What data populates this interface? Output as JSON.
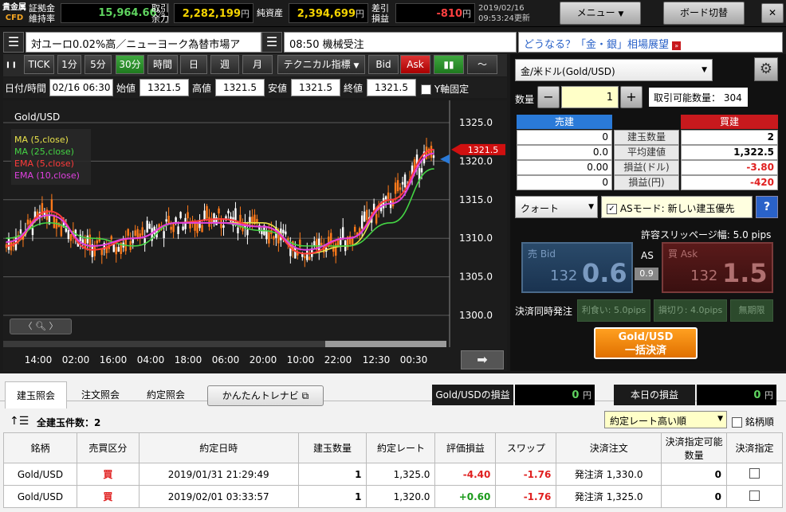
{
  "header": {
    "logo_top": "貴金属",
    "logo_bottom": "CFD",
    "margin_ratio_label_1": "証拠金",
    "margin_ratio_label_2": "維持率",
    "margin_ratio_value": "15,964.66",
    "margin_ratio_unit": "%",
    "available_label_1": "取引",
    "available_label_2": "余力",
    "available_value": "2,282,199",
    "available_unit": "円",
    "net_assets_label": "純資産",
    "net_assets_value": "2,394,699",
    "net_assets_unit": "円",
    "pl_label_1": "差引",
    "pl_label_2": "損益",
    "pl_value": "-810",
    "pl_unit": "円",
    "date": "2019/02/16",
    "update_time": "09:53:24更新",
    "menu_button": "メニュー",
    "board_switch_button": "ボード切替",
    "close_button": "✕"
  },
  "tickers": {
    "news1": "対ユーロ0.02%高／ニューヨーク為替市場ア",
    "news2": "08:50 機械受注",
    "news3": "どうなる？「金・銀」相場展望"
  },
  "chart_toolbar": {
    "buttons": [
      "TICK",
      "1分",
      "5分",
      "30分",
      "時間",
      "日",
      "週",
      "月"
    ],
    "technical": "テクニカル指標",
    "bid": "Bid",
    "ask": "Ask"
  },
  "ohlc": {
    "datetime_label": "日付/時間",
    "datetime_value": "02/16 06:30",
    "open_label": "始値",
    "open_value": "1321.5",
    "high_label": "高値",
    "high_value": "1321.5",
    "low_label": "安値",
    "low_value": "1321.5",
    "close_label": "終値",
    "close_value": "1321.5",
    "y_fixed_label": "Y軸固定"
  },
  "chart": {
    "symbol": "Gold/USD",
    "legend": [
      {
        "label": "MA (5,close)",
        "color": "#e8e24a"
      },
      {
        "label": "MA (25,close)",
        "color": "#44d444"
      },
      {
        "label": "EMA (5,close)",
        "color": "#ff3b3b"
      },
      {
        "label": "EMA (10,close)",
        "color": "#e040e0"
      }
    ],
    "y_ticks": [
      "1325.0",
      "1320.0",
      "1315.0",
      "1310.0",
      "1305.0",
      "1300.0"
    ],
    "x_ticks": [
      "14:00",
      "02:00",
      "16:00",
      "04:00",
      "18:00",
      "06:00",
      "20:00",
      "10:00",
      "22:00",
      "12:30",
      "00:30"
    ],
    "current_price": "1321.5",
    "up_color": "#ff7a1a",
    "down_color": "#ffffff"
  },
  "chart_data": {
    "type": "line",
    "title": "Gold/USD",
    "ylim": [
      1300,
      1326
    ],
    "x": [
      "14:00",
      "02:00",
      "16:00",
      "04:00",
      "18:00",
      "06:00",
      "20:00",
      "10:00",
      "22:00",
      "12:30",
      "00:30"
    ],
    "series": [
      {
        "name": "MA (5,close)",
        "values": [
          1309,
          1313,
          1309,
          1310,
          1312,
          1312,
          1312,
          1308,
          1309,
          1315,
          1321.5
        ]
      },
      {
        "name": "MA (25,close)",
        "values": [
          1310,
          1312,
          1310,
          1309,
          1312,
          1312,
          1311,
          1309,
          1309,
          1312,
          1319
        ]
      },
      {
        "name": "EMA (5,close)",
        "values": [
          1309,
          1313.5,
          1308.5,
          1310,
          1312,
          1312.5,
          1311.5,
          1308,
          1310,
          1315,
          1321.5
        ]
      },
      {
        "name": "EMA (10,close)",
        "values": [
          1309.5,
          1313,
          1309,
          1310,
          1312,
          1312,
          1311.5,
          1308.5,
          1310,
          1314.5,
          1321
        ]
      }
    ]
  },
  "order_panel": {
    "symbol": "金/米ドル(Gold/USD)",
    "quantity_label": "数量",
    "quantity_value": "1",
    "minus": "−",
    "plus": "+",
    "tradable_label": "取引可能数量：",
    "tradable_value": "304",
    "sell_header": "売建",
    "buy_header": "買建",
    "rows": [
      {
        "sell": "0",
        "label": "建玉数量",
        "buy": "2"
      },
      {
        "sell": "0.0",
        "label": "平均建値",
        "buy": "1,322.5"
      },
      {
        "sell": "0.00",
        "label": "損益(ドル)",
        "buy": "-3.80"
      },
      {
        "sell": "0",
        "label": "損益(円)",
        "buy": "-420"
      }
    ],
    "order_type": "クォート",
    "as_mode": "ASモード: 新しい建玉優先",
    "help": "?",
    "slippage": "許容スリッページ幅: 5.0 pips",
    "sell_bid_label": "売 Bid",
    "sell_bid_small": "132",
    "sell_bid_big": "0.6",
    "as_label": "AS",
    "spread": "0.9",
    "buy_ask_label": "買 Ask",
    "buy_ask_small": "132",
    "buy_ask_big": "1.5",
    "settle_simul_label": "決済同時発注",
    "take_profit": "利食い: 5.0pips",
    "stop_loss": "損切り: 4.0pips",
    "unlimited": "無期限",
    "bulk_settle_1": "Gold/USD",
    "bulk_settle_2": "一括決済"
  },
  "bottom": {
    "tabs": [
      "建玉照会",
      "注文照会",
      "約定照会"
    ],
    "navi_button": "かんたんトレナビ",
    "pl_label": "Gold/USDの損益",
    "pl_value": "0",
    "pl_unit": "円",
    "today_label": "本日の損益",
    "today_value": "0",
    "today_unit": "円",
    "count_label": "全建玉件数：2",
    "sort_value": "約定レート高い順",
    "brand_order_label": "銘柄順",
    "columns": [
      "銘柄",
      "売買区分",
      "約定日時",
      "建玉数量",
      "約定レート",
      "評価損益",
      "スワップ",
      "決済注文",
      "決済指定可能数量",
      "決済指定"
    ],
    "rows": [
      {
        "symbol": "Gold/USD",
        "side": "買",
        "datetime": "2019/01/31 21:29:49",
        "qty": "1",
        "rate": "1,325.0",
        "pl": "-4.40",
        "swap": "-1.76",
        "order": "発注済 1,330.0",
        "avail": "0"
      },
      {
        "symbol": "Gold/USD",
        "side": "買",
        "datetime": "2019/02/01 03:33:57",
        "qty": "1",
        "rate": "1,320.0",
        "pl": "+0.60",
        "swap": "-1.76",
        "order": "発注済 1,325.0",
        "avail": "0"
      }
    ]
  }
}
